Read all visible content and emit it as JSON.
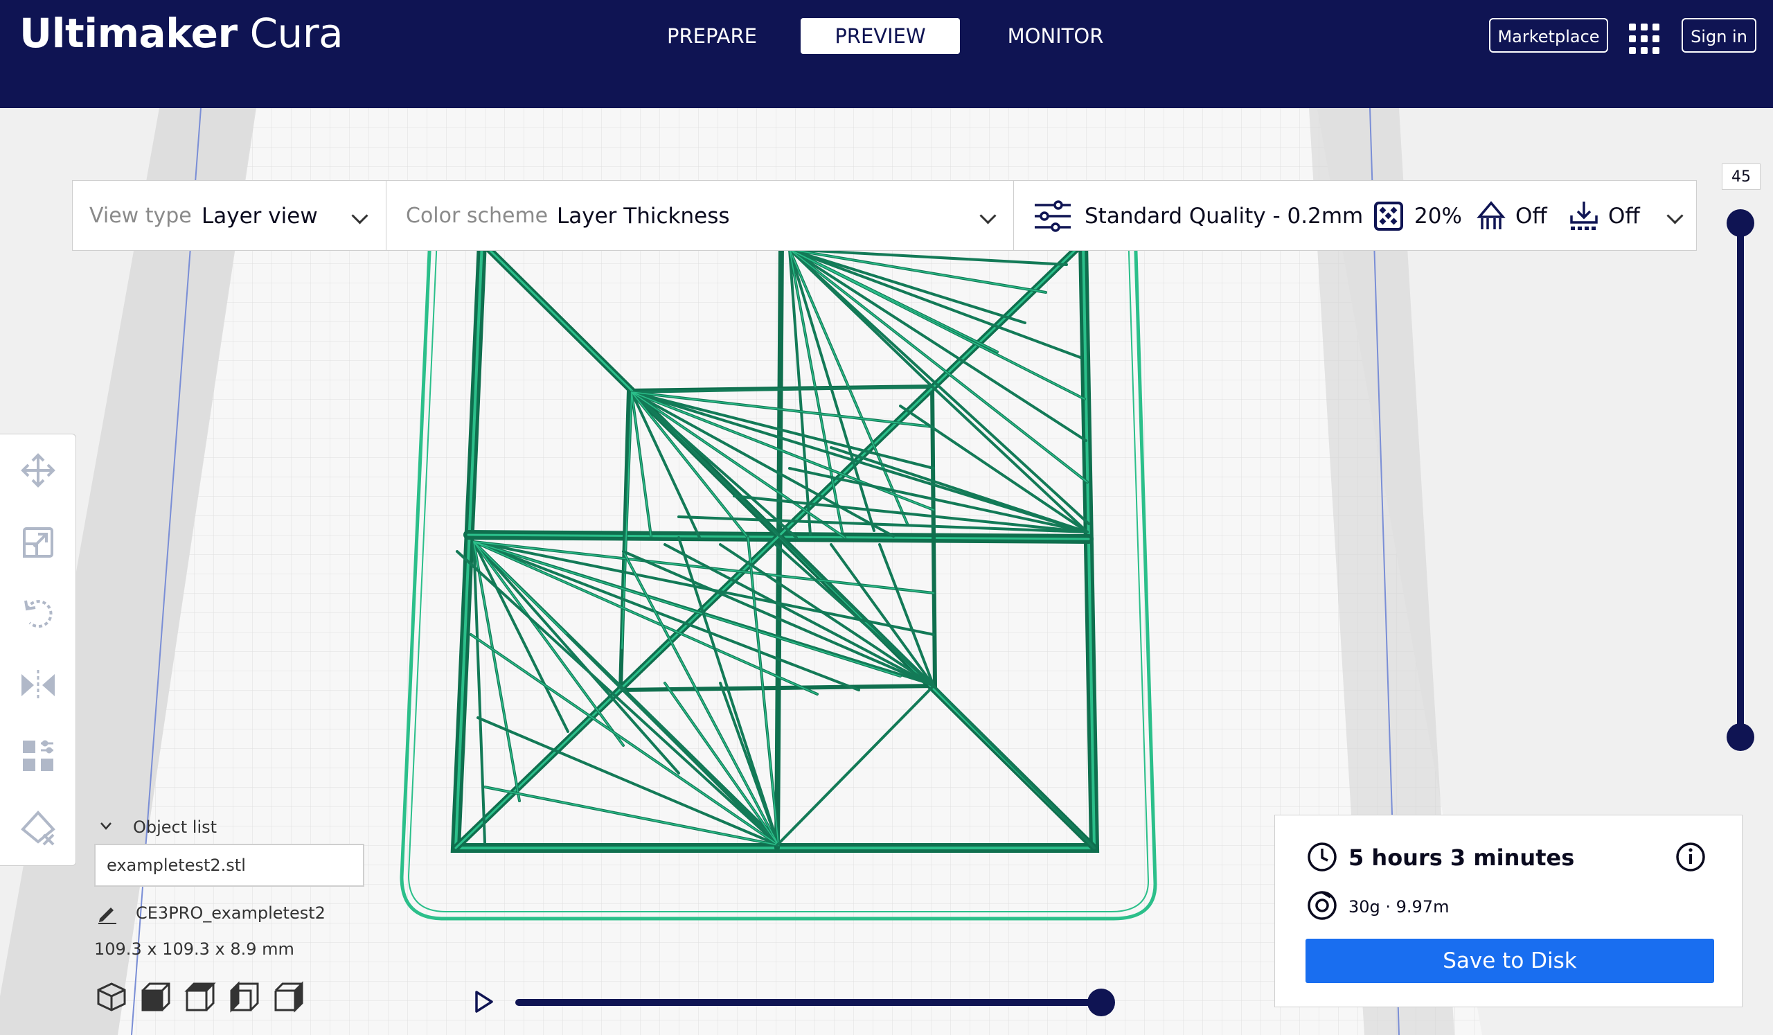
{
  "app": {
    "brand_bold": "Ultimaker",
    "brand_light": "Cura"
  },
  "stages": [
    {
      "label": "PREPARE",
      "active": false
    },
    {
      "label": "PREVIEW",
      "active": true
    },
    {
      "label": "MONITOR",
      "active": false
    }
  ],
  "header": {
    "marketplace_label": "Marketplace",
    "signin_label": "Sign in"
  },
  "toolbar": {
    "view_type_label": "View type",
    "view_type_value": "Layer view",
    "color_scheme_label": "Color scheme",
    "color_scheme_value": "Layer Thickness",
    "quality_value": "Standard Quality - 0.2mm",
    "infill_value": "20%",
    "support_value": "Off",
    "adhesion_value": "Off"
  },
  "tools": [
    "move-tool-icon",
    "scale-tool-icon",
    "rotate-tool-icon",
    "mirror-tool-icon",
    "per-model-settings-icon",
    "support-blocker-icon"
  ],
  "object_list": {
    "header": "Object list",
    "file": "exampletest2.stl",
    "job_name": "CE3PRO_exampletest2",
    "dimensions": "109.3 x 109.3 x 8.9 mm"
  },
  "layer_slider": {
    "current_layer": "45",
    "upper_value_fraction": 1.0,
    "lower_value_fraction": 0.0
  },
  "path_slider": {
    "value_fraction": 1.0
  },
  "print_info": {
    "time": "5 hours 3 minutes",
    "material": "30g · 9.97m",
    "save_label": "Save to Disk"
  },
  "colors": {
    "header_bg": "#0f1453",
    "accent_blue": "#196ef0",
    "layer_green": "#2bbf8a",
    "layer_dark_green": "#0f6f4e"
  }
}
